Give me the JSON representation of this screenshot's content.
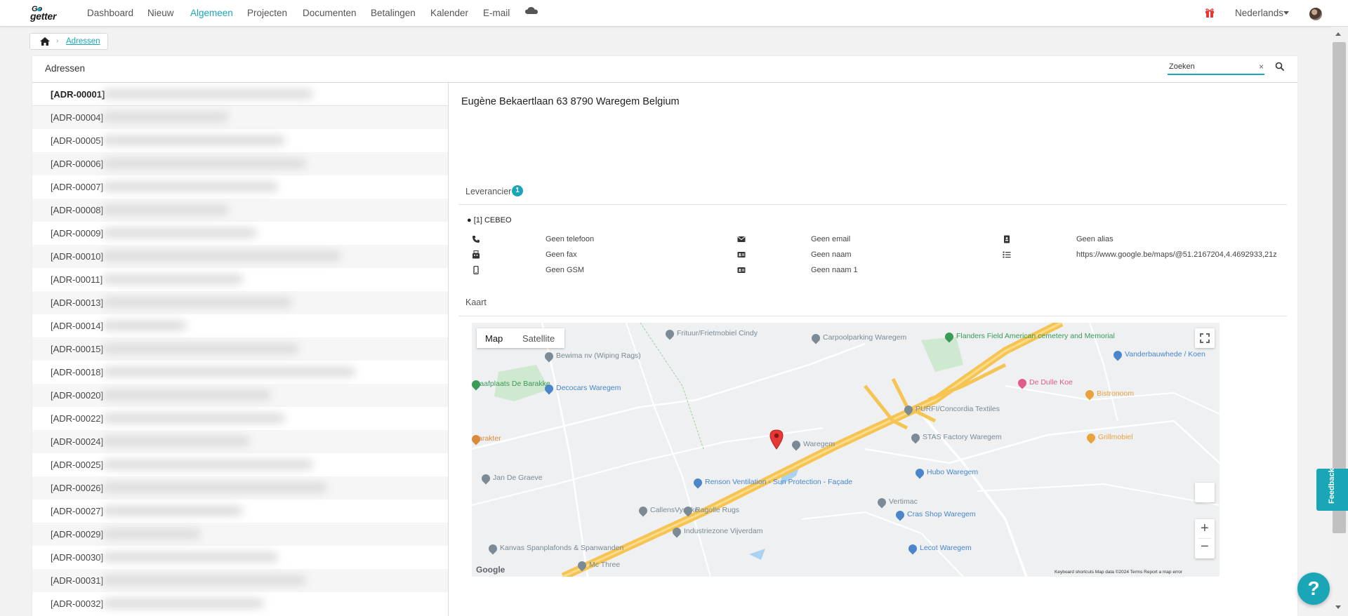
{
  "nav": {
    "logo_top": "Go",
    "logo_bottom": "getter",
    "items": [
      "Dashboard",
      "Nieuw",
      "Algemeen",
      "Projecten",
      "Documenten",
      "Betalingen",
      "Kalender",
      "E-mail"
    ],
    "active_item": "Algemeen",
    "language": "Nederlands"
  },
  "breadcrumb": {
    "current": "Adressen"
  },
  "panel": {
    "title": "Adressen",
    "search_placeholder": "Zoeken",
    "search_clear": "×"
  },
  "list": {
    "items": [
      "[ADR-00001]",
      "[ADR-00004]",
      "[ADR-00005]",
      "[ADR-00006]",
      "[ADR-00007]",
      "[ADR-00008]",
      "[ADR-00009]",
      "[ADR-00010]",
      "[ADR-00011]",
      "[ADR-00013]",
      "[ADR-00014]",
      "[ADR-00015]",
      "[ADR-00018]",
      "[ADR-00020]",
      "[ADR-00022]",
      "[ADR-00024]",
      "[ADR-00025]",
      "[ADR-00026]",
      "[ADR-00027]",
      "[ADR-00029]",
      "[ADR-00030]",
      "[ADR-00031]",
      "[ADR-00032]"
    ],
    "selected_index": 0
  },
  "detail": {
    "address": "Eugène Bekaertlaan 63 8790 Waregem Belgium",
    "supplier_section": "Leverancier",
    "supplier_count": "1",
    "supplier_name": "● [1] CEBEO",
    "fields": {
      "phone": "Geen telefoon",
      "fax": "Geen fax",
      "gsm": "Geen GSM",
      "email": "Geen email",
      "name": "Geen naam",
      "name1": "Geen naam 1",
      "alias": "Geen alias",
      "url": "https://www.google.be/maps/@51.2167204,4.4692933,21z"
    },
    "map_section": "Kaart"
  },
  "map": {
    "tab_map": "Map",
    "tab_satellite": "Satellite",
    "zoom_in": "+",
    "zoom_out": "−",
    "google": "Google",
    "footer": "Keyboard shortcuts     Map data ©2024     Terms     Report a map error",
    "pois": [
      {
        "label": "Frituur/Frietmobiel Cindy",
        "color": "#7b8a95"
      },
      {
        "label": "Carpoolparking Waregem",
        "color": "#7b8a95"
      },
      {
        "label": "Flanders Field American cemetery and Memorial",
        "color": "#3a9a57"
      },
      {
        "label": "Vanderbauwhede / Koen",
        "color": "#4a86c9"
      },
      {
        "label": "Bewima nv (Wiping Rags)",
        "color": "#7b8a95"
      },
      {
        "label": "Decocars Waregem",
        "color": "#4a86c9"
      },
      {
        "label": "graafplaats De Barakke",
        "color": "#3a9a57"
      },
      {
        "label": "De Dulle Koe",
        "color": "#e05a8a"
      },
      {
        "label": "Bistronoom",
        "color": "#e8a33d"
      },
      {
        "label": "PURFI/Concordia Textiles",
        "color": "#7b8a95"
      },
      {
        "label": "STAS Factory Waregem",
        "color": "#7b8a95"
      },
      {
        "label": "Grillmobiel",
        "color": "#e8a33d"
      },
      {
        "label": "Karakter",
        "color": "#d98a3a"
      },
      {
        "label": "Jan De Graeve",
        "color": "#7b8a95"
      },
      {
        "label": "Renson Ventilation - Sun Protection - Façade",
        "color": "#4a86c9"
      },
      {
        "label": "Hubo Waregem",
        "color": "#4a86c9"
      },
      {
        "label": "Vertimac",
        "color": "#7b8a95"
      },
      {
        "label": "CallensVyncke",
        "color": "#7b8a95"
      },
      {
        "label": "Ragolle Rugs",
        "color": "#7b8a95"
      },
      {
        "label": "Industriezone Vijverdam",
        "color": "#7b8a95"
      },
      {
        "label": "Cras Shop Waregem",
        "color": "#4a86c9"
      },
      {
        "label": "Kanvas Spanplafonds & Spanwanden",
        "color": "#7b8a95"
      },
      {
        "label": "Lecot Waregem",
        "color": "#4a86c9"
      },
      {
        "label": "Mc Three",
        "color": "#7b8a95"
      },
      {
        "label": "Waregem",
        "color": "#7b8a95"
      }
    ]
  },
  "widgets": {
    "feedback": "Feedback",
    "help": "?"
  },
  "colors": {
    "accent": "#1aa6b7",
    "pin": "#e53935"
  }
}
